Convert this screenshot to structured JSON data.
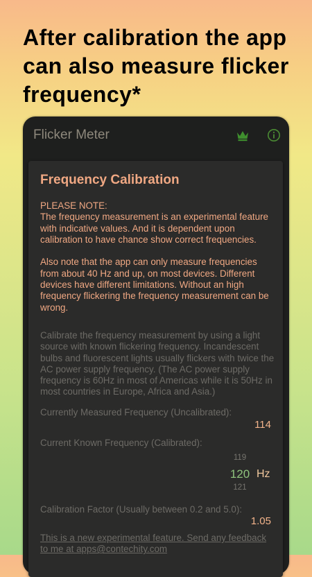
{
  "headline": "After calibration the app can also measure flicker frequency*",
  "appbar": {
    "title": "Flicker Meter",
    "crown_icon": "crown-icon",
    "info_icon": "info-icon"
  },
  "card": {
    "title": "Frequency Calibration",
    "note": "PLEASE NOTE:\nThe frequency measurement is an experimental feature with indicative values. And it is dependent upon calibration to have chance show correct frequencies.\n\nAlso note that the app can only measure frequencies from about 40 Hz and up, on most devices. Different devices have different limitations. Without an high frequency flickering the frequency measurement can be wrong.",
    "instructions": "Calibrate the frequency measurement by using a light source with known flickering frequency. Incandescent bulbs and fluorescent lights usually flickers with twice the AC power supply frequency. (The AC power supply frequency is 60Hz in most of Americas while it is 50Hz in most countries in Europe, Africa and Asia.)",
    "measured_label": "Currently Measured Frequency (Uncalibrated):",
    "measured_value": "114",
    "known_label": "Current Known Frequency (Calibrated):",
    "picker": {
      "above": "119",
      "selected": "120",
      "below": "121",
      "unit": "Hz"
    },
    "factor_label": "Calibration Factor (Usually between 0.2 and 5.0):",
    "factor_value": "1.05",
    "feedback": "This is a new experimental feature. Send any feedback to me at apps@contechity.com"
  },
  "colors": {
    "accent_orange": "#f0a883",
    "picker_green": "#8fc37d",
    "crown_green": "#3f8f2e"
  }
}
